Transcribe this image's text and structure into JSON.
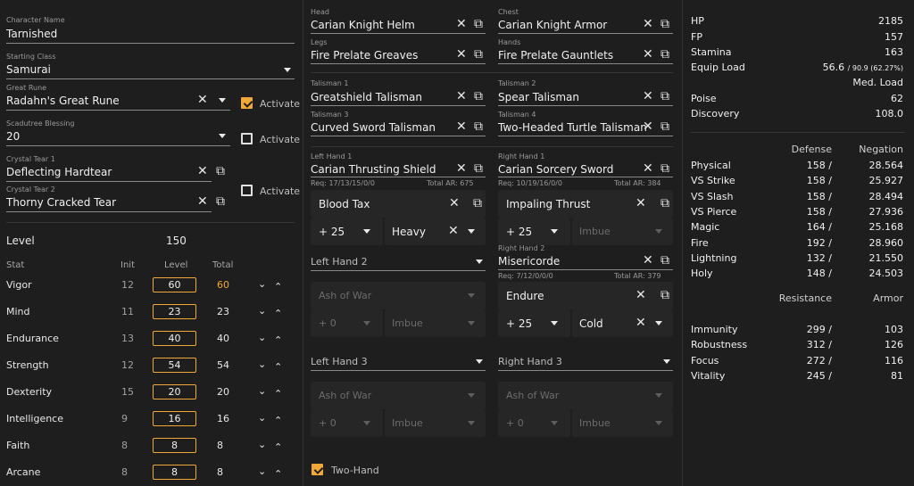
{
  "colors": {
    "accent": "#f0a838",
    "background": "#1e1e1e",
    "card": "#262626"
  },
  "character": {
    "name_label": "Character Name",
    "name": "Tarnished",
    "class_label": "Starting Class",
    "class": "Samurai",
    "great_rune_label": "Great Rune",
    "great_rune": "Radahn's Great Rune",
    "scadutree_label": "Scadutree Blessing",
    "scadutree": "20",
    "crystal1_label": "Crystal Tear 1",
    "crystal1": "Deflecting Hardtear",
    "crystal2_label": "Crystal Tear 2",
    "crystal2": "Thorny Cracked Tear",
    "activate": "Activate",
    "level_label": "Level",
    "level": "150"
  },
  "stats_header": {
    "stat": "Stat",
    "init": "Init",
    "level": "Level",
    "total": "Total"
  },
  "stats": [
    {
      "name": "Vigor",
      "init": "12",
      "level": "60",
      "total": "60",
      "highlight": true
    },
    {
      "name": "Mind",
      "init": "11",
      "level": "23",
      "total": "23"
    },
    {
      "name": "Endurance",
      "init": "13",
      "level": "40",
      "total": "40"
    },
    {
      "name": "Strength",
      "init": "12",
      "level": "54",
      "total": "54"
    },
    {
      "name": "Dexterity",
      "init": "15",
      "level": "20",
      "total": "20"
    },
    {
      "name": "Intelligence",
      "init": "9",
      "level": "16",
      "total": "16"
    },
    {
      "name": "Faith",
      "init": "8",
      "level": "8",
      "total": "8"
    },
    {
      "name": "Arcane",
      "init": "8",
      "level": "8",
      "total": "8"
    }
  ],
  "armor": {
    "head_label": "Head",
    "head": "Carian Knight Helm",
    "chest_label": "Chest",
    "chest": "Carian Knight Armor",
    "legs_label": "Legs",
    "legs": "Fire Prelate Greaves",
    "hands_label": "Hands",
    "hands": "Fire Prelate Gauntlets"
  },
  "talismans": {
    "t1_label": "Talisman 1",
    "t1": "Greatshield Talisman",
    "t2_label": "Talisman 2",
    "t2": "Spear Talisman",
    "t3_label": "Talisman 3",
    "t3": "Curved Sword Talisman",
    "t4_label": "Talisman 4",
    "t4": "Two-Headed Turtle Talisman"
  },
  "weapons": {
    "lh1_label": "Left Hand 1",
    "lh1": "Carian Thrusting Shield",
    "lh1_req": "Req: 17/13/15/0/0",
    "lh1_ar": "Total AR: 675",
    "lh1_aow": "Blood Tax",
    "lh1_upgrade": "+ 25",
    "lh1_affinity": "Heavy",
    "rh1_label": "Right Hand 1",
    "rh1": "Carian Sorcery Sword",
    "rh1_req": "Req: 10/19/16/0/0",
    "rh1_ar": "Total AR: 384",
    "rh1_aow": "Impaling Thrust",
    "rh1_upgrade": "+ 25",
    "rh1_affinity": "Imbue",
    "lh2": "Left Hand 2",
    "lh2_aow": "Ash of War",
    "lh2_upgrade": "+ 0",
    "lh2_affinity": "Imbue",
    "rh2_label": "Right Hand 2",
    "rh2": "Misericorde",
    "rh2_req": "Req: 7/12/0/0/0",
    "rh2_ar": "Total AR: 379",
    "rh2_aow": "Endure",
    "rh2_upgrade": "+ 25",
    "rh2_affinity": "Cold",
    "lh3": "Left Hand 3",
    "lh3_aow": "Ash of War",
    "lh3_upgrade": "+ 0",
    "lh3_affinity": "Imbue",
    "rh3": "Right Hand 3",
    "rh3_aow": "Ash of War",
    "rh3_upgrade": "+ 0",
    "rh3_affinity": "Imbue",
    "two_hand": "Two-Hand"
  },
  "summary": [
    {
      "label": "HP",
      "value": "2185"
    },
    {
      "label": "FP",
      "value": "157"
    },
    {
      "label": "Stamina",
      "value": "163"
    },
    {
      "label": "Equip Load",
      "value": "56.6",
      "value_detail": "/ 90.9 (62.27%)",
      "sub": "Med. Load"
    },
    {
      "label": "Poise",
      "value": "62"
    },
    {
      "label": "Discovery",
      "value": "108.0"
    }
  ],
  "defense_header": {
    "defense": "Defense",
    "negation": "Negation"
  },
  "defense": [
    {
      "label": "Physical",
      "defense": "158 /",
      "negation": "28.564"
    },
    {
      "label": "VS Strike",
      "defense": "158 /",
      "negation": "25.927"
    },
    {
      "label": "VS Slash",
      "defense": "158 /",
      "negation": "28.494"
    },
    {
      "label": "VS Pierce",
      "defense": "158 /",
      "negation": "27.936"
    },
    {
      "label": "Magic",
      "defense": "164 /",
      "negation": "25.168"
    },
    {
      "label": "Fire",
      "defense": "192 /",
      "negation": "28.960"
    },
    {
      "label": "Lightning",
      "defense": "132 /",
      "negation": "21.550"
    },
    {
      "label": "Holy",
      "defense": "148 /",
      "negation": "24.503"
    }
  ],
  "resistance_header": {
    "resistance": "Resistance",
    "armor": "Armor"
  },
  "resistance": [
    {
      "label": "Immunity",
      "resistance": "299 /",
      "armor": "103"
    },
    {
      "label": "Robustness",
      "resistance": "312 /",
      "armor": "126"
    },
    {
      "label": "Focus",
      "resistance": "272 /",
      "armor": "116"
    },
    {
      "label": "Vitality",
      "resistance": "245 /",
      "armor": "81"
    }
  ]
}
